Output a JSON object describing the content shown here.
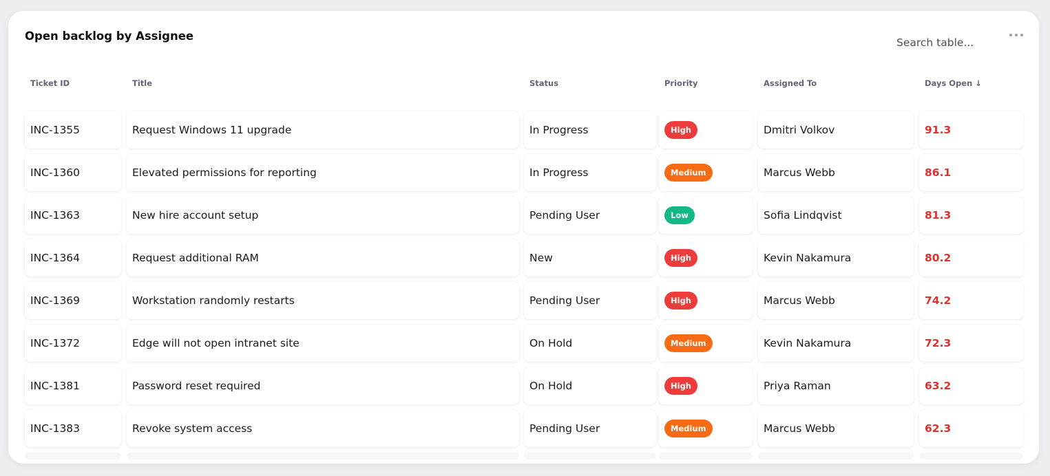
{
  "widget": {
    "title": "Open backlog by Assignee",
    "search_placeholder": "Search table...",
    "more_icon": "more-horizontal-icon"
  },
  "colors": {
    "high": "#ee3b3b",
    "medium": "#f76b15",
    "low": "#12b886",
    "days_open": "#e03131"
  },
  "table": {
    "columns": [
      {
        "key": "ticket_id",
        "label": "Ticket ID"
      },
      {
        "key": "title",
        "label": "Title"
      },
      {
        "key": "status",
        "label": "Status"
      },
      {
        "key": "priority",
        "label": "Priority"
      },
      {
        "key": "assigned_to",
        "label": "Assigned To"
      },
      {
        "key": "days_open",
        "label": "Days Open ↓"
      }
    ],
    "rows": [
      {
        "ticket_id": "INC-1355",
        "title": "Request Windows 11 upgrade",
        "status": "In Progress",
        "priority": "High",
        "assigned_to": "Dmitri Volkov",
        "days_open": "91.3"
      },
      {
        "ticket_id": "INC-1360",
        "title": "Elevated permissions for reporting",
        "status": "In Progress",
        "priority": "Medium",
        "assigned_to": "Marcus Webb",
        "days_open": "86.1"
      },
      {
        "ticket_id": "INC-1363",
        "title": "New hire account setup",
        "status": "Pending User",
        "priority": "Low",
        "assigned_to": "Sofia Lindqvist",
        "days_open": "81.3"
      },
      {
        "ticket_id": "INC-1364",
        "title": "Request additional RAM",
        "status": "New",
        "priority": "High",
        "assigned_to": "Kevin Nakamura",
        "days_open": "80.2"
      },
      {
        "ticket_id": "INC-1369",
        "title": "Workstation randomly restarts",
        "status": "Pending User",
        "priority": "High",
        "assigned_to": "Marcus Webb",
        "days_open": "74.2"
      },
      {
        "ticket_id": "INC-1372",
        "title": "Edge will not open intranet site",
        "status": "On Hold",
        "priority": "Medium",
        "assigned_to": "Kevin Nakamura",
        "days_open": "72.3"
      },
      {
        "ticket_id": "INC-1381",
        "title": "Password reset required",
        "status": "On Hold",
        "priority": "High",
        "assigned_to": "Priya Raman",
        "days_open": "63.2"
      },
      {
        "ticket_id": "INC-1383",
        "title": "Revoke system access",
        "status": "Pending User",
        "priority": "Medium",
        "assigned_to": "Marcus Webb",
        "days_open": "62.3"
      }
    ]
  }
}
